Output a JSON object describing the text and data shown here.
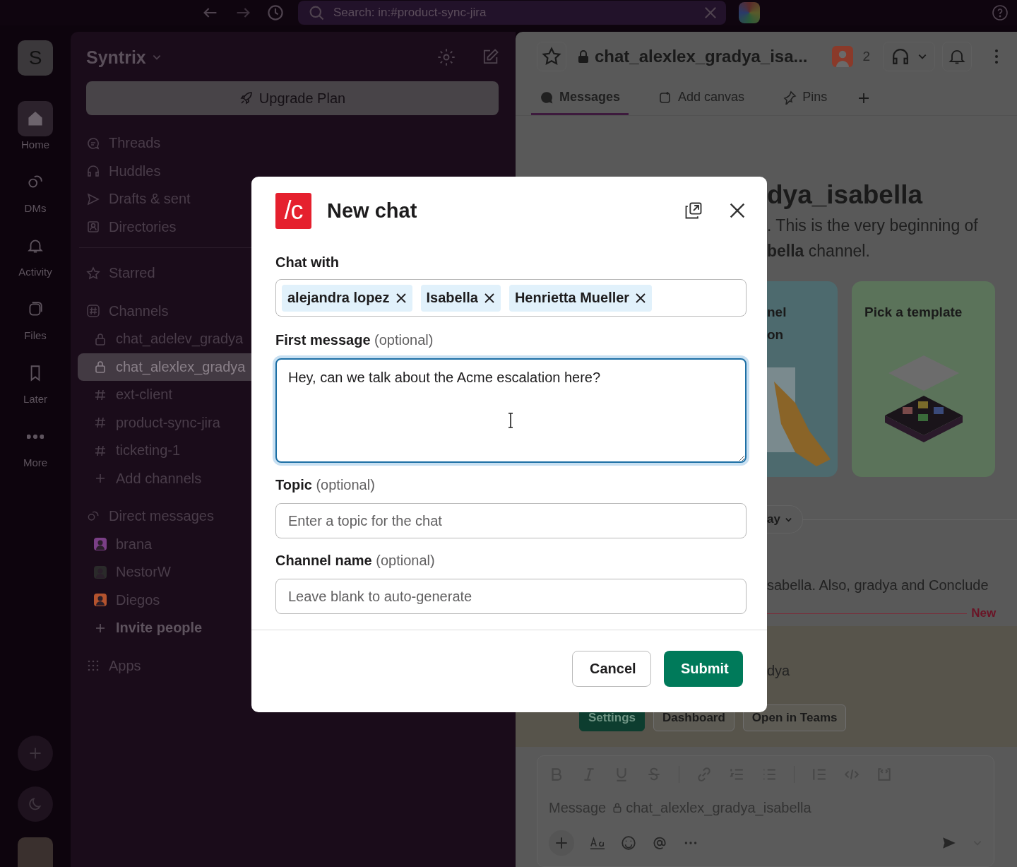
{
  "topbar": {
    "search": {
      "placeholder": "Search: in:#product-sync-jira"
    }
  },
  "workspace": {
    "initial": "S",
    "name": "Syntrix"
  },
  "rail": [
    {
      "label": "Home",
      "kind": "home",
      "selected": true
    },
    {
      "label": "DMs",
      "kind": "dms",
      "selected": false
    },
    {
      "label": "Activity",
      "kind": "activity",
      "selected": false
    },
    {
      "label": "Files",
      "kind": "files",
      "selected": false
    },
    {
      "label": "Later",
      "kind": "later",
      "selected": false
    },
    {
      "label": "More",
      "kind": "more",
      "selected": false
    }
  ],
  "sidebar": {
    "upgrade": "Upgrade Plan",
    "nav": [
      {
        "label": "Threads",
        "kind": "threads"
      },
      {
        "label": "Huddles",
        "kind": "huddles"
      },
      {
        "label": "Drafts & sent",
        "kind": "drafts"
      },
      {
        "label": "Directories",
        "kind": "directories"
      }
    ],
    "starred": "Starred",
    "channels": {
      "title": "Channels",
      "items": [
        {
          "label": "chat_adelev_gradya",
          "kind": "private",
          "selected": false
        },
        {
          "label": "chat_alexlex_gradya",
          "kind": "private",
          "selected": true
        },
        {
          "label": "ext-client",
          "kind": "public",
          "selected": false
        },
        {
          "label": "product-sync-jira",
          "kind": "public",
          "selected": false
        },
        {
          "label": "ticketing-1",
          "kind": "public",
          "selected": false
        },
        {
          "label": "Add channels",
          "kind": "add",
          "selected": false
        }
      ]
    },
    "direct_messages": {
      "title": "Direct messages",
      "items": [
        {
          "label": "brana",
          "color": "#7a3f86"
        },
        {
          "label": "NestorW",
          "color": "#2a2a2a"
        },
        {
          "label": "Diegos",
          "color": "#b4532e"
        }
      ]
    },
    "invite": "Invite people",
    "apps": "Apps"
  },
  "main": {
    "title": "chat_alexlex_gradya_isa...",
    "member_count": "2",
    "tabs": [
      {
        "label": "Messages",
        "kind": "messages",
        "selected": true
      },
      {
        "label": "Add canvas",
        "kind": "canvas",
        "selected": false
      },
      {
        "label": "Pins",
        "kind": "pins",
        "selected": false
      }
    ],
    "intro_title": "dya_isabella",
    "intro_lines": [
      ". This is the very beginning of",
      "**bella** channel."
    ],
    "cards": [
      {
        "kind": "hand",
        "lines": [
          "nel",
          "on"
        ]
      },
      {
        "kind": "template",
        "lines": [
          "Pick a template"
        ]
      }
    ],
    "date_pill": "ay",
    "message_text": "sabella. Also, gradya and Conclude",
    "new_label": "New",
    "sender": "dya",
    "actions": [
      {
        "label": "Settings",
        "kind": "primary"
      },
      {
        "label": "Dashboard",
        "kind": "secondary"
      },
      {
        "label": "Open in Teams",
        "kind": "secondary"
      }
    ],
    "composer": {
      "placeholder": "Message",
      "channel": "chat_alexlex_gradya_isabella"
    }
  },
  "modal": {
    "logo": "/c",
    "title": "New chat",
    "chat_with": {
      "label": "Chat with",
      "chips": [
        "alejandra lopez",
        "Isabella",
        "Henrietta Mueller"
      ]
    },
    "first_message": {
      "label": "First message",
      "hint": "(optional)",
      "value": "Hey, can we talk about the Acme escalation here?",
      "focused": true
    },
    "topic": {
      "label": "Topic",
      "hint": "(optional)",
      "placeholder": "Enter a topic for the chat"
    },
    "channel_name": {
      "label": "Channel name",
      "hint": "(optional)",
      "placeholder": "Leave blank to auto-generate"
    },
    "cancel": "Cancel",
    "submit": "Submit"
  }
}
